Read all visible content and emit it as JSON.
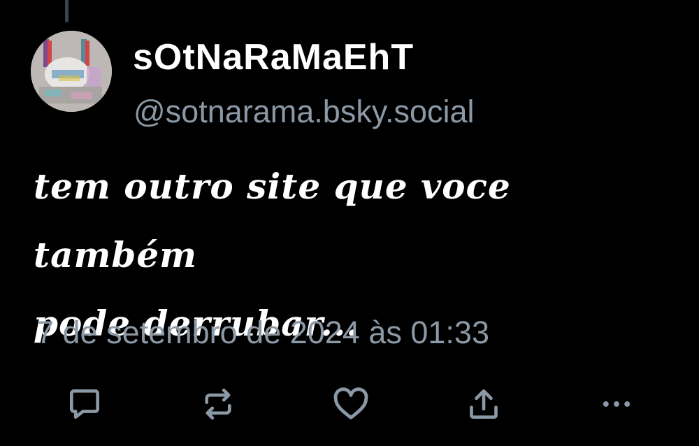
{
  "post": {
    "author": {
      "display_name": "sOtNaRaMaEhT",
      "handle": "@sotnarama.bsky.social"
    },
    "text_line_1": "tem outro site que voce também",
    "text_line_2": "pode derrubar...",
    "timestamp": "7 de setembro de 2024 às 01:33"
  },
  "actions": [
    {
      "name": "reply",
      "icon": "speech-bubble-icon"
    },
    {
      "name": "repost",
      "icon": "repost-icon"
    },
    {
      "name": "like",
      "icon": "heart-icon"
    },
    {
      "name": "share",
      "icon": "share-icon"
    },
    {
      "name": "more",
      "icon": "ellipsis-icon"
    }
  ],
  "colors": {
    "background": "#000000",
    "primary_text": "#ffffff",
    "secondary_text": "#8b98a5",
    "icon": "#8b98a5"
  }
}
